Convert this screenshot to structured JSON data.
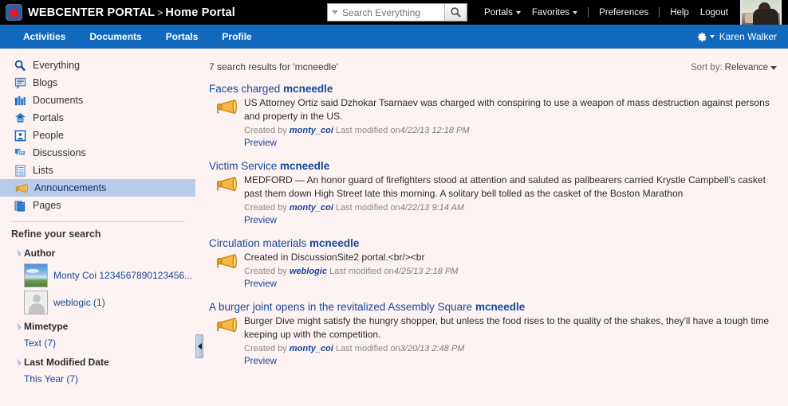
{
  "header": {
    "brand": "WEBCENTER PORTAL",
    "separator": ">",
    "page": "Home Portal",
    "logo_icon": "webcenter-logo-icon",
    "search": {
      "placeholder": "Search Everything",
      "value": "",
      "caret_icon": "chevron-down-icon",
      "button_icon": "search-icon"
    },
    "links": [
      {
        "label": "Portals",
        "caret": true
      },
      {
        "label": "Favorites",
        "caret": true
      },
      {
        "label": "Preferences",
        "caret": false
      },
      {
        "label": "Help",
        "caret": false
      },
      {
        "label": "Logout",
        "caret": false
      }
    ],
    "avatar_icon": "user-avatar-photo"
  },
  "navbar": {
    "tabs": [
      {
        "label": "Activities"
      },
      {
        "label": "Documents"
      },
      {
        "label": "Portals"
      },
      {
        "label": "Profile"
      }
    ],
    "gear_icon": "gear-icon",
    "gear_caret_icon": "chevron-down-icon",
    "username": "Karen Walker"
  },
  "sidebar": {
    "items": [
      {
        "label": "Everything",
        "icon": "magnifier-icon",
        "active": false
      },
      {
        "label": "Blogs",
        "icon": "blog-icon",
        "active": false
      },
      {
        "label": "Documents",
        "icon": "documents-icon",
        "active": false
      },
      {
        "label": "Portals",
        "icon": "portals-house-icon",
        "active": false
      },
      {
        "label": "People",
        "icon": "people-icon",
        "active": false
      },
      {
        "label": "Discussions",
        "icon": "discussions-icon",
        "active": false
      },
      {
        "label": "Lists",
        "icon": "lists-icon",
        "active": false
      },
      {
        "label": "Announcements",
        "icon": "megaphone-icon",
        "active": true
      },
      {
        "label": "Pages",
        "icon": "pages-icon",
        "active": false
      }
    ],
    "refine_title": "Refine your search",
    "facets": [
      {
        "name": "Author",
        "toggle_icon": "disclosure-triangle-icon",
        "options": [
          {
            "label": "Monty Coi 1234567890123456...",
            "thumb": "landscape-photo-thumb"
          },
          {
            "label": "weblogic (1)",
            "thumb": "default-person-thumb"
          }
        ]
      },
      {
        "name": "Mimetype",
        "toggle_icon": "disclosure-triangle-icon",
        "options": [
          {
            "label": "Text (7)",
            "thumb": null
          }
        ]
      },
      {
        "name": "Last Modified Date",
        "toggle_icon": "disclosure-triangle-icon",
        "options": [
          {
            "label": "This Year (7)",
            "thumb": null
          }
        ]
      }
    ],
    "splitter_icon": "collapse-left-arrow-icon"
  },
  "results_header": {
    "count_text": "7 search results for 'mcneedle'",
    "sort_label": "Sort by:",
    "sort_value": "Relevance",
    "sort_caret_icon": "chevron-down-icon"
  },
  "results": [
    {
      "title_plain": "Faces charged ",
      "title_highlight": "mcneedle",
      "icon": "megaphone-icon",
      "snippet": "US Attorney Ortiz said Dzhokar Tsarnaev was charged with conspiring to use a weapon of mass destruction against persons and property in the US.",
      "created_by_label": "Created by ",
      "author": "monty_coi",
      "modified_label": " Last modified on",
      "modified": "4/22/13 12:18 PM",
      "preview_label": "Preview"
    },
    {
      "title_plain": "Victim Service ",
      "title_highlight": "mcneedle",
      "icon": "megaphone-icon",
      "snippet": "MEDFORD — An honor guard of firefighters stood at attention and saluted as pallbearers carried Krystle Campbell's casket past them down High Street late this morning. A solitary bell tolled as the casket of the Boston Marathon",
      "created_by_label": "Created by ",
      "author": "monty_coi",
      "modified_label": " Last modified on",
      "modified": "4/22/13 9:14 AM",
      "preview_label": "Preview"
    },
    {
      "title_plain": "Circulation materials ",
      "title_highlight": "mcneedle",
      "icon": "megaphone-icon",
      "snippet": "Created in DiscussionSite2 portal.<br/><br",
      "created_by_label": "Created by ",
      "author": "weblogic",
      "modified_label": " Last modified on",
      "modified": "4/25/13 2:18 PM",
      "preview_label": "Preview"
    },
    {
      "title_plain": "A burger joint opens in the revitalized Assembly Square ",
      "title_highlight": "mcneedle",
      "icon": "megaphone-icon",
      "snippet": "Burger Dive might satisfy the hungry shopper, but unless the food rises to the quality of the shakes, they'll have a tough time keeping up with the competition.",
      "created_by_label": "Created by ",
      "author": "monty_coi",
      "modified_label": " Last modified on",
      "modified": "3/20/13 2:48 PM",
      "preview_label": "Preview"
    }
  ],
  "colors": {
    "topbar": "#000000",
    "navbar_blue": "#1268bd",
    "link_blue": "#15489b",
    "page_bg": "#fdf2f2",
    "active_item": "#b7cbea",
    "accent_red": "#e8181c"
  }
}
